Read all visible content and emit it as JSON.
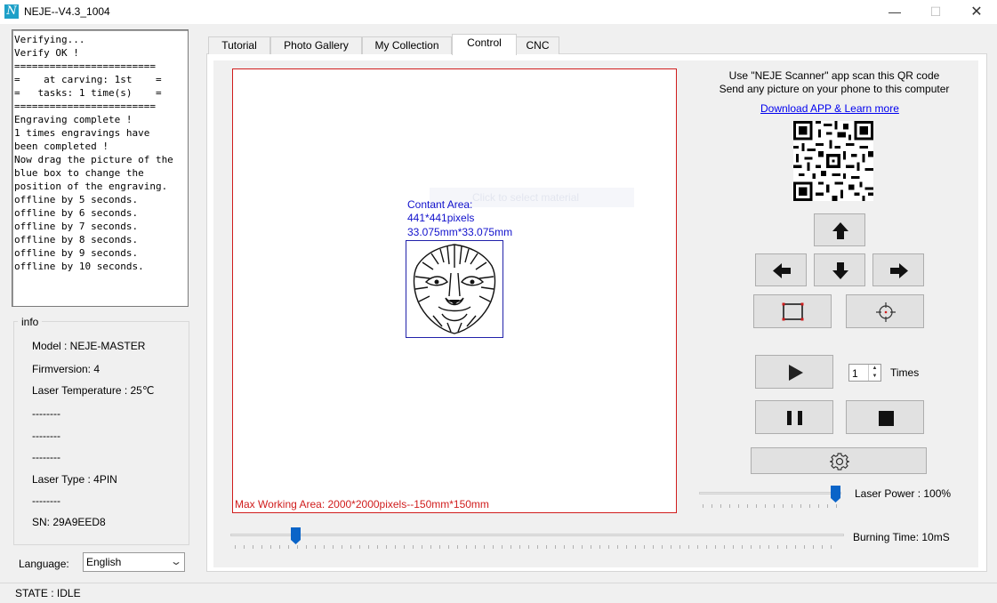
{
  "window": {
    "title": "NEJE--V4.3_1004",
    "icon_letter": "N",
    "minimize": "—",
    "maximize": "☐",
    "close": "✕"
  },
  "log": {
    "lines": [
      "Verifying...",
      "Verify OK !",
      "========================",
      "=    at carving: 1st    =",
      "=   tasks: 1 time(s)    =",
      "========================",
      "Engraving complete !",
      "1 times engravings have",
      "been completed !",
      "",
      "Now drag the picture of the",
      "blue box to change the",
      "position of the engraving.",
      "",
      "offline by 5 seconds.",
      "offline by 6 seconds.",
      "offline by 7 seconds.",
      "offline by 8 seconds.",
      "offline by 9 seconds.",
      "offline by 10 seconds."
    ]
  },
  "info": {
    "legend": "info",
    "lines": [
      "Model : NEJE-MASTER",
      "Firmversion: 4",
      "Laser Temperature : 25℃",
      "--------",
      "--------",
      "--------",
      "Laser Type : 4PIN",
      "--------",
      "SN: 29A9EED8"
    ]
  },
  "language": {
    "label": "Language:",
    "selected": "English"
  },
  "tabs": [
    {
      "label": "Tutorial",
      "active": false
    },
    {
      "label": "Photo Gallery",
      "active": false
    },
    {
      "label": "My Collection",
      "active": false
    },
    {
      "label": "Control",
      "active": true
    },
    {
      "label": "CNC",
      "active": false
    }
  ],
  "workspace": {
    "ghost_text": "Click to select material",
    "content_area_title": "Contant Area:",
    "content_pixels": "441*441pixels",
    "content_mm": "33.075mm*33.075mm",
    "max_working_area": "Max Working Area: 2000*2000pixels--150mm*150mm"
  },
  "qr": {
    "line1": "Use \"NEJE Scanner\" app scan this QR code",
    "line2": "Send any picture on your phone to this computer",
    "link": "Download APP & Learn more"
  },
  "controls": {
    "move_up": "arrow-up-icon",
    "move_left": "arrow-left-icon",
    "move_down": "arrow-down-icon",
    "move_right": "arrow-right-icon",
    "preview_frame": "frame-icon",
    "center": "crosshair-icon",
    "start": "play-icon",
    "pause": "pause-icon",
    "stop": "stop-icon",
    "settings": "gear-icon",
    "times_value": "1",
    "times_label": "Times"
  },
  "laser_power": {
    "label": "Laser Power : 100%",
    "value_percent": 100
  },
  "burning_time": {
    "label": "Burning Time: 10mS",
    "value_fraction": 0.1
  },
  "status": {
    "text": "STATE : IDLE"
  },
  "colors": {
    "work_area_border": "#d01c1c",
    "content_text": "#1111cc",
    "slider_thumb": "#0a64c8",
    "link": "#0000ee"
  }
}
